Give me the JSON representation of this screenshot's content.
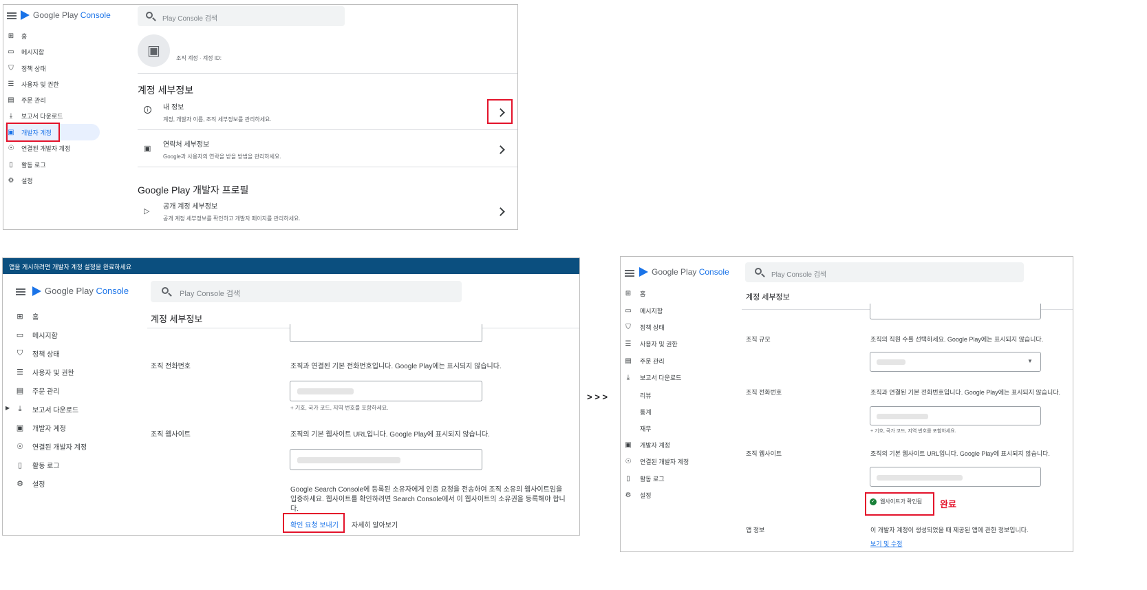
{
  "brand": {
    "word1": "Google Play",
    "word2": " Console"
  },
  "search": {
    "placeholder": "Play Console 검색"
  },
  "nav": {
    "home": "홈",
    "inbox": "메시지함",
    "policy": "정책 상태",
    "users": "사용자 및 권한",
    "orders": "주문 관리",
    "downloads": "보고서 다운로드",
    "developer_account": "개발자 계정",
    "linked_accounts": "연결된 개발자 계정",
    "activity_log": "활동 로그",
    "settings": "설정",
    "reviews": "리뷰",
    "statistics": "통계",
    "finance": "재무"
  },
  "panel1": {
    "account_meta": "조직 계정  ·  계정 ID:",
    "section1_title": "계정 세부정보",
    "row1_title": "내 정보",
    "row1_sub": "계정, 개발자 이름, 조직 세부정보를 관리하세요.",
    "row2_title": "연락처 세부정보",
    "row2_sub": "Google과 사용자의 연락을 받을 방법을 관리하세요.",
    "section2_title": "Google Play 개발자 프로필",
    "row3_title": "공개 계정 세부정보",
    "row3_sub": "공개 계정 세부정보를 확인하고 개발자 페이지를 관리하세요."
  },
  "panel2": {
    "banner": "앱을 게시하려면 개발자 계정 설정을 완료하세요",
    "page_title": "계정 세부정보",
    "phone_label": "조직 전화번호",
    "phone_desc": "조직과 연결된 기본 전화번호입니다. Google Play에는 표시되지 않습니다.",
    "phone_hint": "+ 기호, 국가 코드, 지역 번호를 포함하세요.",
    "website_label": "조직 웹사이트",
    "website_desc": "조직의 기본 웹사이트 URL입니다. Google Play에 표시되지 않습니다.",
    "verify_line1": "Google Search Console에 등록된 소유자에게 인증 요청을 전송하여 조직 소유의 웹사이트임을",
    "verify_line2": "입증하세요. 웹사이트를 확인하려면 Search Console에서 이 웹사이트의 소유권을 등록해야 합니",
    "verify_line3": "다.",
    "send_request": "확인 요청 보내기",
    "learn_more": "자세히 알아보기"
  },
  "arrow": "> > >",
  "panel3": {
    "page_title": "계정 세부정보",
    "size_label": "조직 규모",
    "size_desc": "조직의 직원 수를 선택하세요. Google Play에는 표시되지 않습니다.",
    "phone_label": "조직 전화번호",
    "phone_desc": "조직과 연결된 기본 전화번호입니다. Google Play에는 표시되지 않습니다.",
    "phone_hint": "+ 기호, 국가 코드, 지역 번호를 포함하세요.",
    "website_label": "조직 웹사이트",
    "website_desc": "조직의 기본 웹사이트 URL입니다. Google Play에 표시되지 않습니다.",
    "verified_chip": "웹사이트가 확인됨",
    "done_label": "완료",
    "app_info_label": "앱 정보",
    "app_info_desc": "이 개발자 계정이 생성되었을 때 제공된 앱에 관한 정보입니다.",
    "view_edit": "보기 및 수정"
  },
  "colors": {
    "accent": "#1a73e8",
    "banner": "#0b4f7f",
    "highlight": "#e3122a",
    "verified": "#188038",
    "selected_bg": "#e8f0fe"
  }
}
